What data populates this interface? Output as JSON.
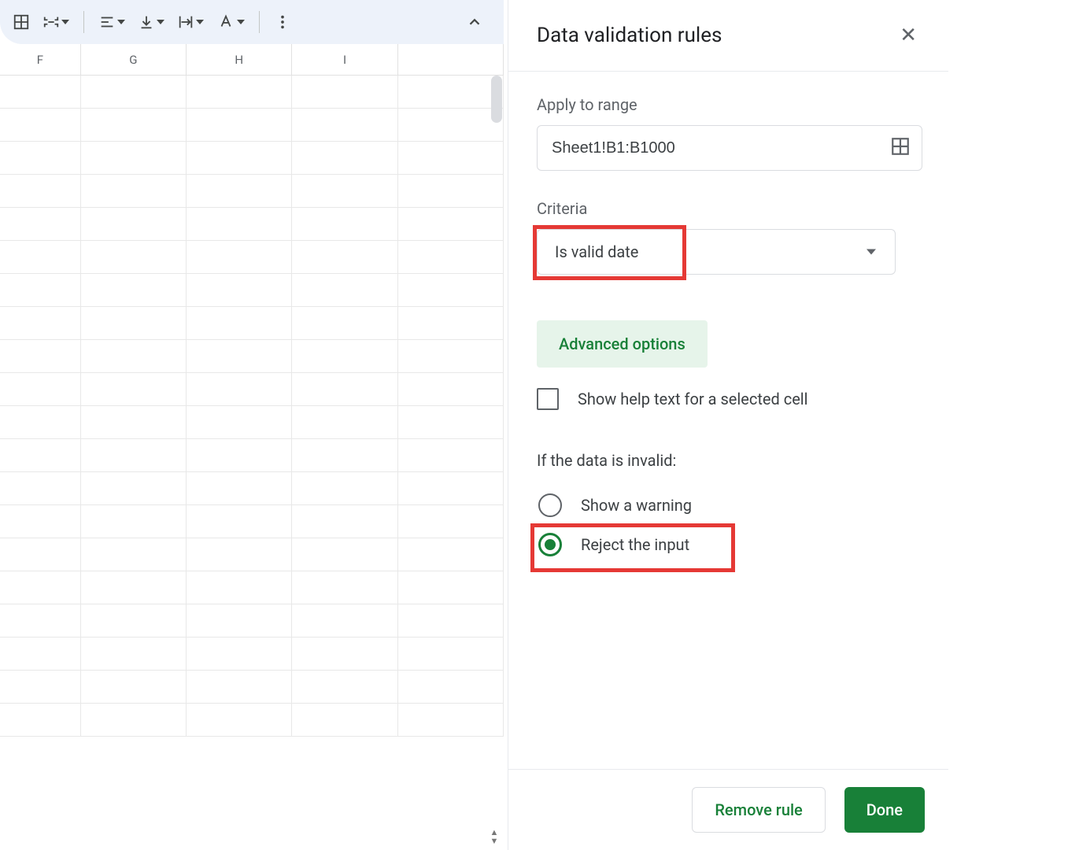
{
  "toolbar": {
    "icons": {
      "borders": "borders-icon",
      "merge": "merge-cells-icon",
      "halign": "horizontal-align-icon",
      "valign": "vertical-align-icon",
      "wrap": "text-wrap-icon",
      "rotate": "text-rotate-icon",
      "more": "more-vert-icon",
      "collapse": "chevron-up-icon"
    }
  },
  "columns": {
    "widths": [
      130,
      170,
      170,
      170,
      170
    ],
    "labels": [
      "F",
      "G",
      "H",
      "I",
      ""
    ]
  },
  "row_count": 20,
  "panel": {
    "title": "Data validation rules",
    "apply_label": "Apply to range",
    "range_value": "Sheet1!B1:B1000",
    "criteria_label": "Criteria",
    "criteria_value": "Is valid date",
    "advanced_label": "Advanced options",
    "help_text_label": "Show help text for a selected cell",
    "help_text_checked": false,
    "invalid_label": "If the data is invalid:",
    "radio_warning": "Show a warning",
    "radio_reject": "Reject the input",
    "selected_invalid": "reject",
    "remove_label": "Remove rule",
    "done_label": "Done"
  }
}
